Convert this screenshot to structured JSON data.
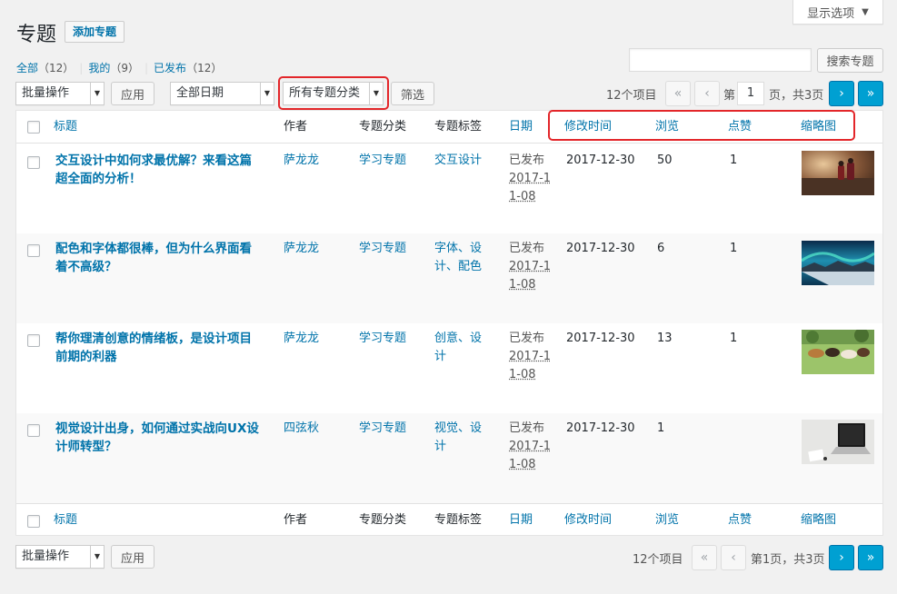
{
  "screen_options": {
    "label": "显示选项"
  },
  "page": {
    "title": "专题",
    "add_button": "添加专题"
  },
  "views": [
    {
      "label": "全部",
      "count": "（12）"
    },
    {
      "label": "我的",
      "count": "（9）"
    },
    {
      "label": "已发布",
      "count": "（12）"
    }
  ],
  "search": {
    "button": "搜索专题",
    "value": ""
  },
  "filters_top": {
    "bulk": "批量操作",
    "apply": "应用",
    "dates": "全部日期",
    "category": "所有专题分类",
    "filter": "筛选"
  },
  "pagination_top": {
    "items": "12个项目",
    "page_prefix": "第",
    "current": "1",
    "page_suffix": "页，共3页"
  },
  "pagination_bottom": {
    "items": "12个项目",
    "text": "第1页，共3页"
  },
  "columns": {
    "title": "标题",
    "author": "作者",
    "category": "专题分类",
    "tags": "专题标签",
    "date": "日期",
    "modified": "修改时间",
    "views": "浏览",
    "likes": "点赞",
    "thumb": "缩略图"
  },
  "rows": [
    {
      "title_l1": "交互设计中如何求最优解？来看这篇",
      "title_l2": "超全面的分析！",
      "author": "萨龙龙",
      "category": "学习专题",
      "tags_l1": "交互设计",
      "tags_l2": "",
      "status": "已发布",
      "date_l1": "2017-1",
      "date_l2": "1-08",
      "modified": "2017-12-30",
      "views": "50",
      "likes": "1"
    },
    {
      "title_l1": "配色和字体都很棒，但为什么界面看",
      "title_l2": "着不高级？",
      "author": "萨龙龙",
      "category": "学习专题",
      "tags_l1": "字体、设",
      "tags_l2": "计、配色",
      "status": "已发布",
      "date_l1": "2017-1",
      "date_l2": "1-08",
      "modified": "2017-12-30",
      "views": "6",
      "likes": "1"
    },
    {
      "title_l1": "帮你理清创意的情绪板，是设计项目",
      "title_l2": "前期的利器",
      "author": "萨龙龙",
      "category": "学习专题",
      "tags_l1": "创意、设",
      "tags_l2": "计",
      "status": "已发布",
      "date_l1": "2017-1",
      "date_l2": "1-08",
      "modified": "2017-12-30",
      "views": "13",
      "likes": "1"
    },
    {
      "title_l1": "视觉设计出身，如何通过实战向UX设",
      "title_l2": "计师转型？",
      "author": "四弦秋",
      "category": "学习专题",
      "tags_l1": "视觉、设",
      "tags_l2": "计",
      "status": "已发布",
      "date_l1": "2017-1",
      "date_l2": "1-08",
      "modified": "2017-12-30",
      "views": "1",
      "likes": ""
    }
  ],
  "filters_bottom": {
    "bulk": "批量操作",
    "apply": "应用"
  },
  "icons": {
    "first": "«",
    "prev": "‹",
    "next": "›",
    "last": "»",
    "caret": "▼"
  },
  "colors": {
    "link": "#0073aa",
    "highlight": "#e3262a",
    "pager_active": "#00a0d2"
  }
}
